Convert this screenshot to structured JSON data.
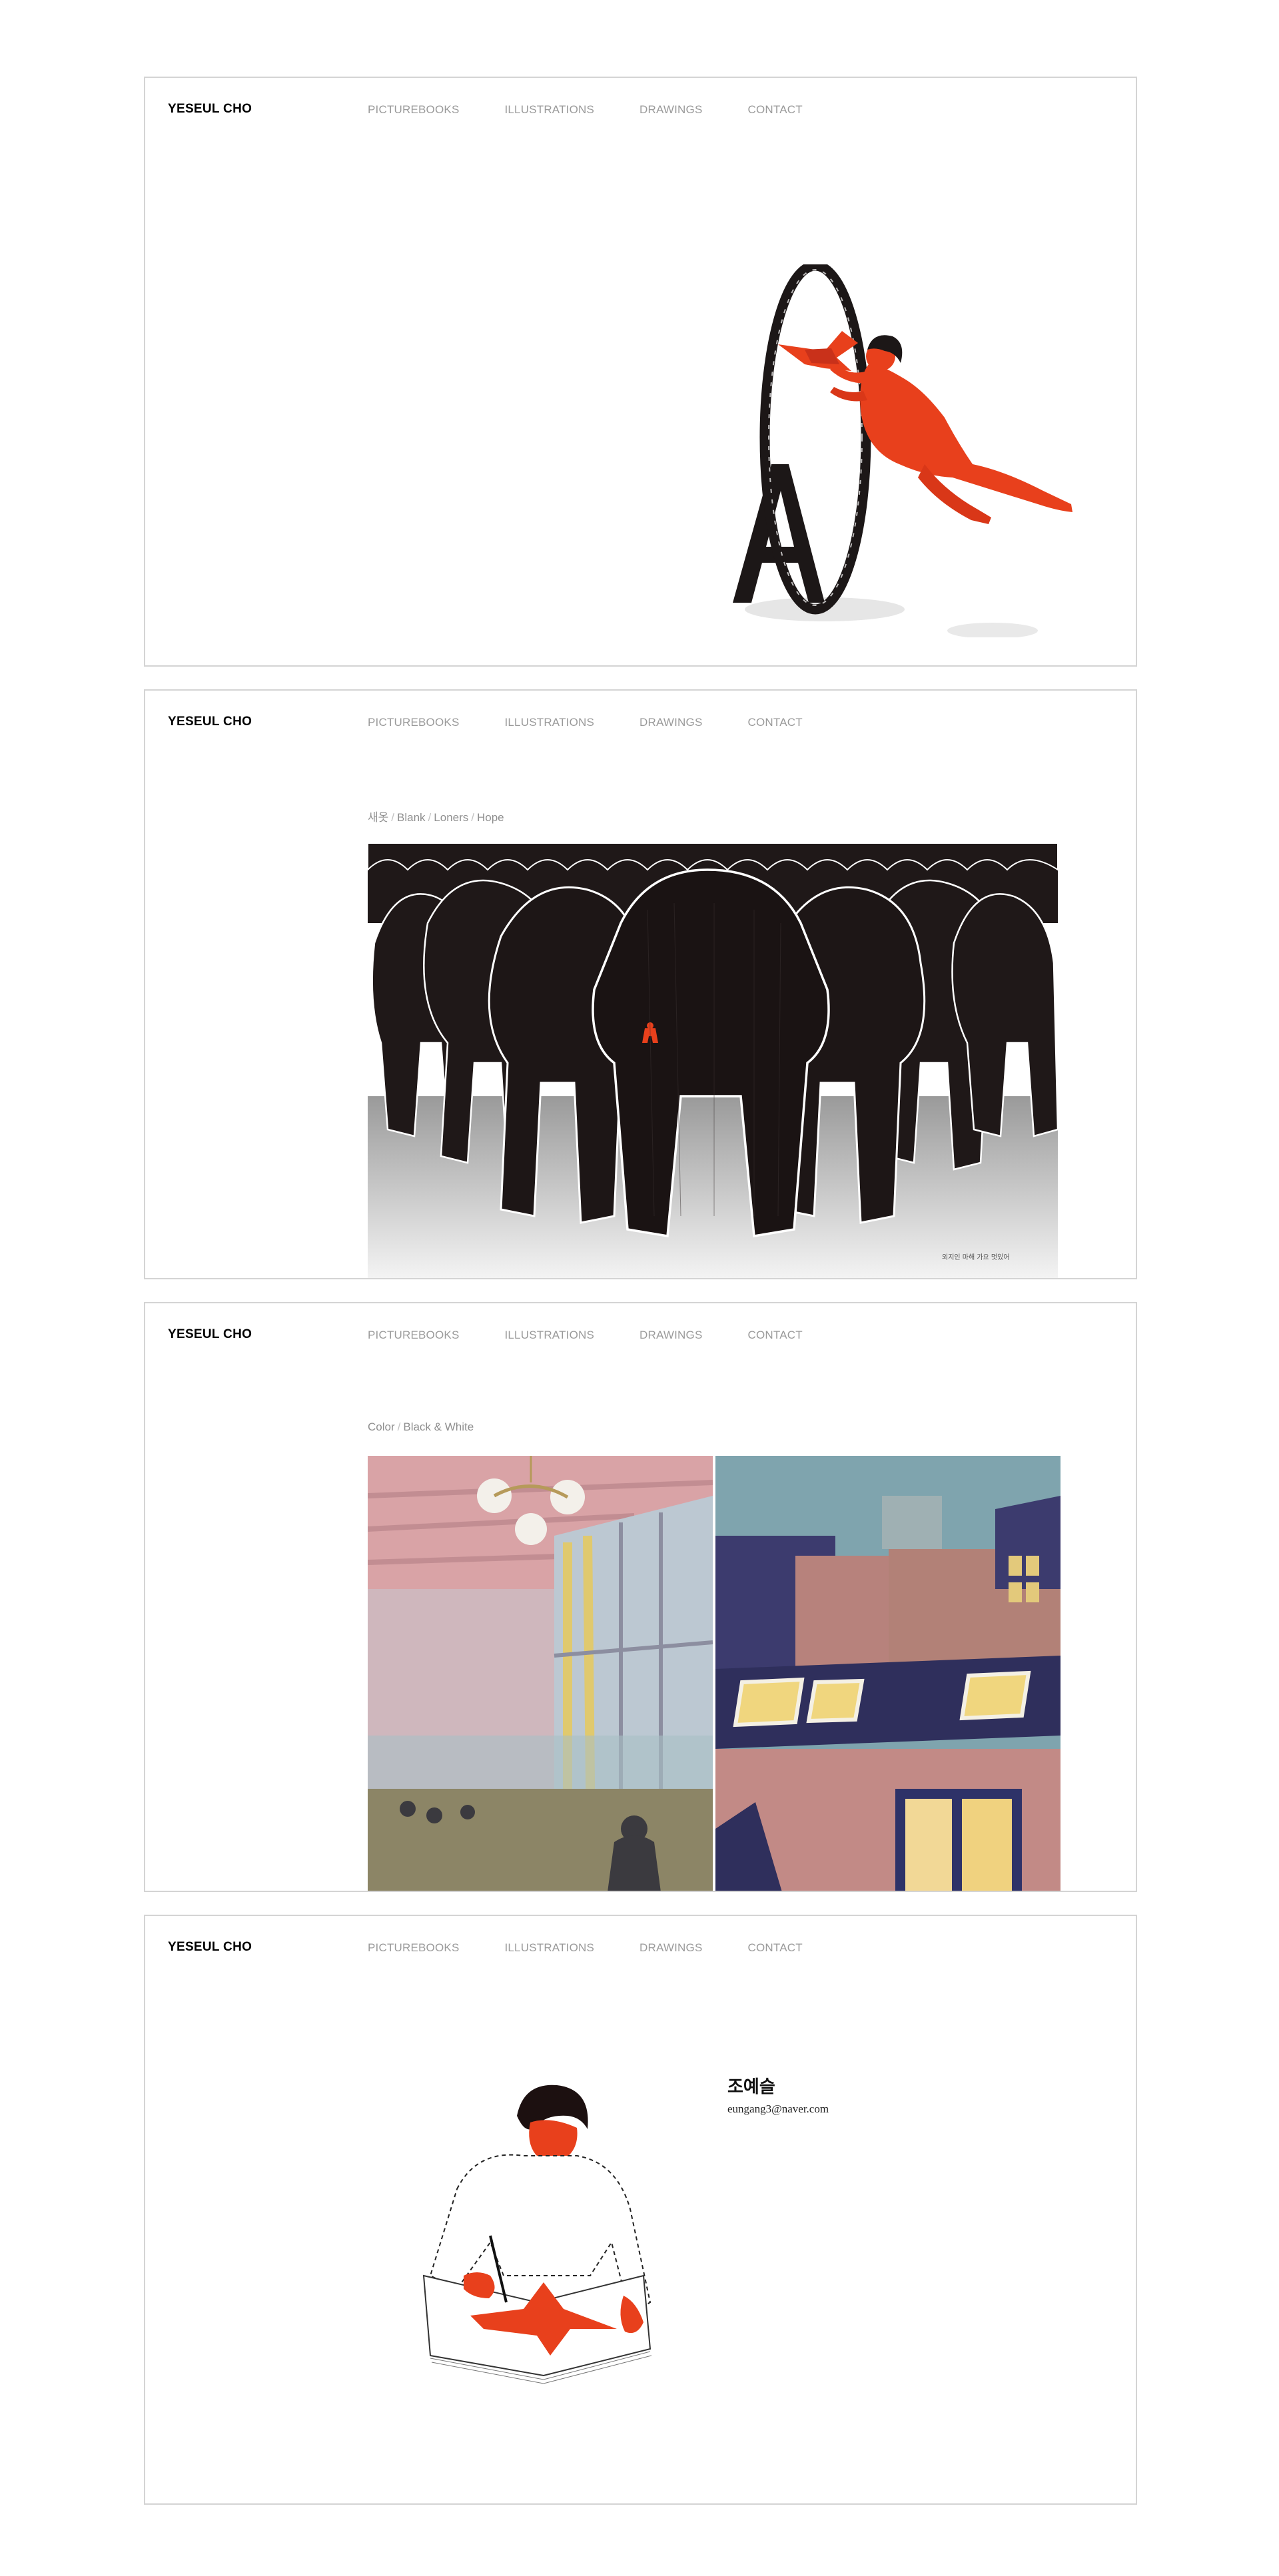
{
  "brand": "YESEUL CHO",
  "nav": {
    "picturebooks": "PICTUREBOOKS",
    "illustrations": "ILLUSTRATIONS",
    "drawings": "DRAWINGS",
    "contact": "CONTACT"
  },
  "picturebooks": {
    "tabs": [
      "새옷",
      "Blank",
      "Loners",
      "Hope"
    ],
    "caption": "외지인 마해 가요 멋있어"
  },
  "drawings": {
    "tabs": [
      "Color",
      "Black & White"
    ]
  },
  "contact": {
    "name": "조예슬",
    "email": "eungang3@naver.com"
  },
  "colors": {
    "accent_red": "#e8401c",
    "ink": "#1a1414",
    "border": "#d4d4d4",
    "nav_gray": "#9a9a9a"
  }
}
